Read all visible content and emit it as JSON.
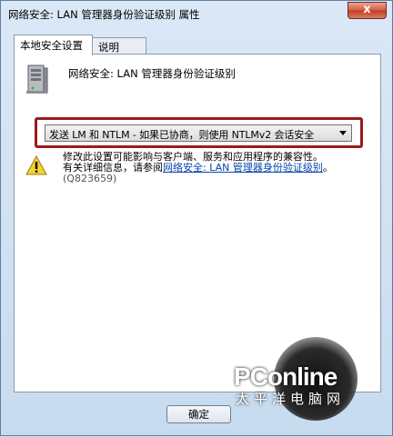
{
  "window": {
    "title": "网络安全: LAN 管理器身份验证级别 属性",
    "close_label": "x"
  },
  "tabs": [
    {
      "label": "本地安全设置",
      "active": true
    },
    {
      "label": "说明",
      "active": false
    }
  ],
  "panel": {
    "policy_title": "网络安全: LAN 管理器身份验证级别",
    "dropdown": {
      "selected": "发送 LM 和 NTLM - 如果已协商，则使用 NTLMv2 会话安全"
    },
    "warning": {
      "line1": "修改此设置可能影响与客户端、服务和应用程序的兼容性。",
      "line2_prefix": "有关详细信息，请参阅",
      "link": "网络安全: LAN 管理器身份验证级别",
      "line2_suffix": "。",
      "kb": "(Q823659)"
    }
  },
  "buttons": {
    "ok_label": "确定"
  },
  "watermark": {
    "logo": "PConline",
    "site_cn": "太平洋电脑网"
  },
  "colors": {
    "highlight_border": "#9b1b1b",
    "link": "#0645ad",
    "close_button": "#c23a22"
  }
}
